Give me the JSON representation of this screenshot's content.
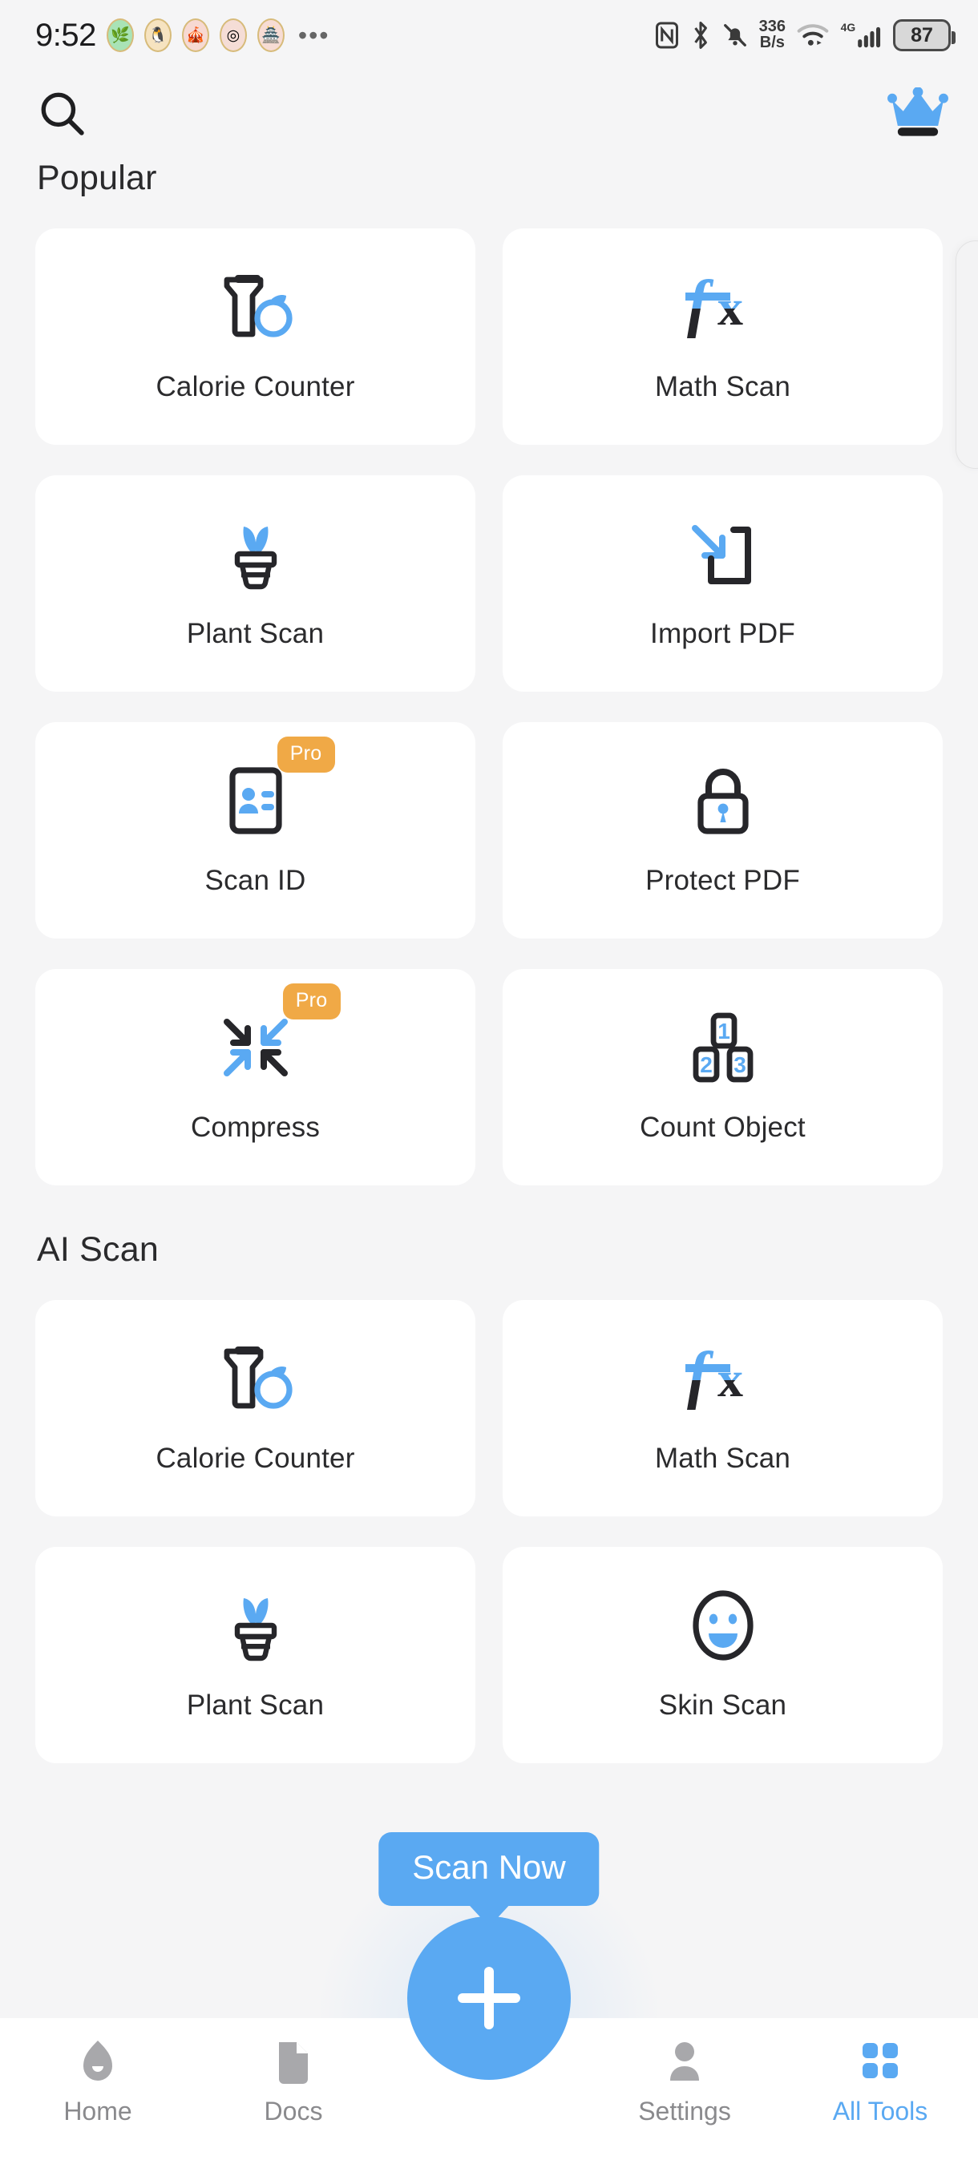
{
  "status_bar": {
    "time": "9:52",
    "app_icons": [
      "🌿",
      "🐧",
      "🎪",
      "◎",
      "🏯"
    ],
    "overflow": "•••",
    "network_speed": "336",
    "network_speed_unit": "B/s",
    "network_type": "4G",
    "battery_level": "87",
    "icons": [
      "nfc-icon",
      "bluetooth-icon",
      "mute-icon",
      "wifi-icon",
      "cellular-signal-icon",
      "battery-icon"
    ]
  },
  "top_bar": {
    "search_icon": "search-icon",
    "premium_icon": "crown-icon",
    "premium_color": "#5aa9f2"
  },
  "theme": {
    "accent": "#5aa9f2",
    "pro_badge": "#f0a946",
    "background": "#f5f5f6",
    "card": "#ffffff",
    "text": "#2b2b2d",
    "muted": "#8a8a8d"
  },
  "sections": [
    {
      "title": "Popular",
      "items": [
        {
          "label": "Calorie Counter",
          "icon": "calorie-counter-icon",
          "pro": false
        },
        {
          "label": "Math Scan",
          "icon": "math-scan-icon",
          "pro": false
        },
        {
          "label": "Plant Scan",
          "icon": "plant-scan-icon",
          "pro": false
        },
        {
          "label": "Import PDF",
          "icon": "import-pdf-icon",
          "pro": false
        },
        {
          "label": "Scan ID",
          "icon": "scan-id-icon",
          "pro": true,
          "pro_label": "Pro"
        },
        {
          "label": "Protect PDF",
          "icon": "protect-pdf-icon",
          "pro": false
        },
        {
          "label": "Compress",
          "icon": "compress-icon",
          "pro": true,
          "pro_label": "Pro"
        },
        {
          "label": "Count Object",
          "icon": "count-object-icon",
          "pro": false
        }
      ]
    },
    {
      "title": "AI Scan",
      "items": [
        {
          "label": "Calorie Counter",
          "icon": "calorie-counter-icon",
          "pro": false
        },
        {
          "label": "Math Scan",
          "icon": "math-scan-icon",
          "pro": false
        },
        {
          "label": "Plant Scan",
          "icon": "plant-scan-icon",
          "pro": false
        },
        {
          "label": "Skin Scan",
          "icon": "skin-scan-icon",
          "pro": false
        }
      ]
    }
  ],
  "tooltip": {
    "text": "Scan Now"
  },
  "fab": {
    "icon": "plus-icon",
    "label": "Scan"
  },
  "bottom_nav": {
    "items": [
      {
        "label": "Home",
        "icon": "home-icon",
        "active": false
      },
      {
        "label": "Docs",
        "icon": "docs-icon",
        "active": false
      },
      {
        "label": "Settings",
        "icon": "settings-user-icon",
        "active": false
      },
      {
        "label": "All Tools",
        "icon": "grid-icon",
        "active": true
      }
    ]
  }
}
